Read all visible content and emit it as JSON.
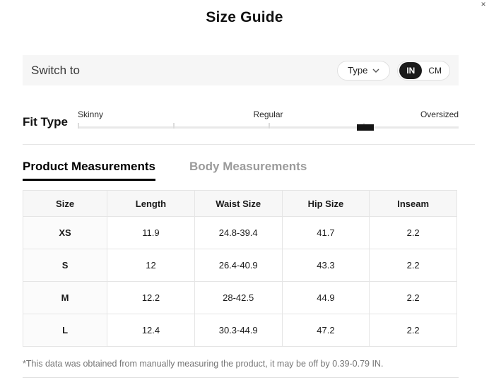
{
  "title": "Size Guide",
  "switch": {
    "label": "Switch to",
    "type_button": "Type",
    "units": [
      {
        "label": "IN",
        "active": true
      },
      {
        "label": "CM",
        "active": false
      }
    ]
  },
  "fit_type": {
    "label": "Fit Type",
    "stops": [
      "Skinny",
      "Regular",
      "Oversized"
    ],
    "indicator_percent": 75.5,
    "tick_percents": [
      0,
      25,
      50,
      75
    ]
  },
  "tabs": [
    {
      "label": "Product Measurements",
      "active": true
    },
    {
      "label": "Body Measurements",
      "active": false
    }
  ],
  "table": {
    "headers": [
      "Size",
      "Length",
      "Waist Size",
      "Hip Size",
      "Inseam"
    ],
    "rows": [
      [
        "XS",
        "11.9",
        "24.8-39.4",
        "41.7",
        "2.2"
      ],
      [
        "S",
        "12",
        "26.4-40.9",
        "43.3",
        "2.2"
      ],
      [
        "M",
        "12.2",
        "28-42.5",
        "44.9",
        "2.2"
      ],
      [
        "L",
        "12.4",
        "30.3-44.9",
        "47.2",
        "2.2"
      ]
    ]
  },
  "note": "*This data was obtained from manually measuring the product, it may be off by 0.39-0.79 IN.",
  "colors": {
    "accent": "#1a1a1a",
    "bar_background": "#f6f6f6",
    "border": "#e5e5e5",
    "inactive_tab": "#9b9b9b",
    "note_text": "#767676"
  }
}
